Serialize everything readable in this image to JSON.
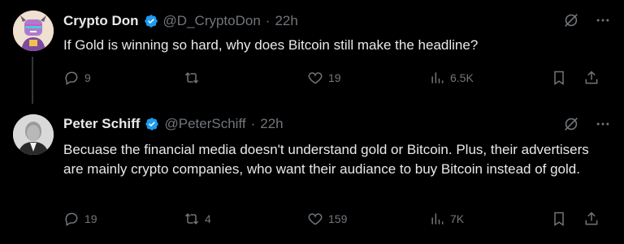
{
  "tweets": [
    {
      "name": "Crypto Don",
      "handle": "@D_CryptoDon",
      "dot": "·",
      "time": "22h",
      "text": "If Gold is winning so hard, why does Bitcoin still make the headline?",
      "replies": "9",
      "retweets": "",
      "likes": "19",
      "views": "6.5K"
    },
    {
      "name": "Peter Schiff",
      "handle": "@PeterSchiff",
      "dot": "·",
      "time": "22h",
      "text": "Becuase the financial media doesn't understand gold or Bitcoin. Plus, their advertisers are mainly crypto companies, who want their audiance to buy Bitcoin instead of gold.",
      "replies": "19",
      "retweets": "4",
      "likes": "159",
      "views": "7K"
    }
  ],
  "colors": {
    "background": "#000000",
    "text": "#e7e9ea",
    "muted": "#71767b",
    "verified": "#1d9bf0"
  },
  "icons": [
    "verified-badge-icon",
    "grok-icon",
    "more-icon",
    "reply-icon",
    "retweet-icon",
    "like-icon",
    "views-icon",
    "bookmark-icon",
    "share-icon"
  ]
}
